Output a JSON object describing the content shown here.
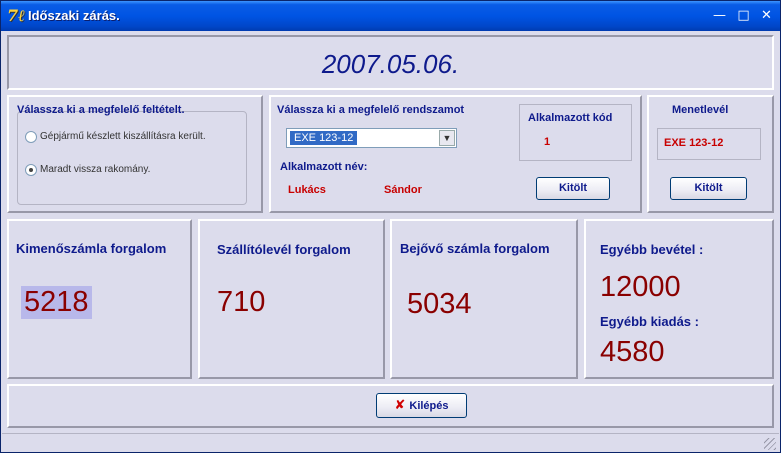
{
  "window": {
    "title": "Időszaki zárás.",
    "icon": "app-logo-icon",
    "controls": {
      "minimize": "—",
      "maximize": "□",
      "close": "✕"
    }
  },
  "date": "2007.05.06.",
  "conditions": {
    "title": "Válassza ki a megfelelő feltételt.",
    "options": [
      {
        "label": "Gépjármű készlett kiszállításra került.",
        "selected": false
      },
      {
        "label": "Maradt vissza rakomány.",
        "selected": true
      }
    ]
  },
  "vehicle": {
    "title": "Válassza ki a megfelelő rendszamot",
    "selected_plate": "EXE 123-12",
    "employee_name_label": "Alkalmazott név:",
    "employee_first": "Lukács",
    "employee_last": "Sándor",
    "employee_code_label": "Alkalmazott kód",
    "employee_code": "1",
    "fill_button": "Kitölt"
  },
  "route_sheet": {
    "title": "Menetlevél",
    "value": "EXE 123-12",
    "fill_button": "Kitölt"
  },
  "stats": {
    "outgoing_invoice_label": "Kimenőszámla forgalom",
    "outgoing_invoice_value": "5218",
    "delivery_note_label": "Szállítólevél forgalom",
    "delivery_note_value": "710",
    "incoming_invoice_label": "Bejővő számla forgalom",
    "incoming_invoice_value": "5034",
    "other_income_label": "Egyébb bevétel :",
    "other_income_value": "12000",
    "other_expense_label": "Egyébb kiadás :",
    "other_expense_value": "4580"
  },
  "footer": {
    "exit_button": "Kilépés",
    "exit_icon": "close-x-icon"
  },
  "colors": {
    "label_blue": "#0e1a8c",
    "value_red": "#c80000",
    "stat_dark_red": "#8a0000",
    "panel_bg": "#dcdcec",
    "titlebar_blue": "#0054e3"
  }
}
